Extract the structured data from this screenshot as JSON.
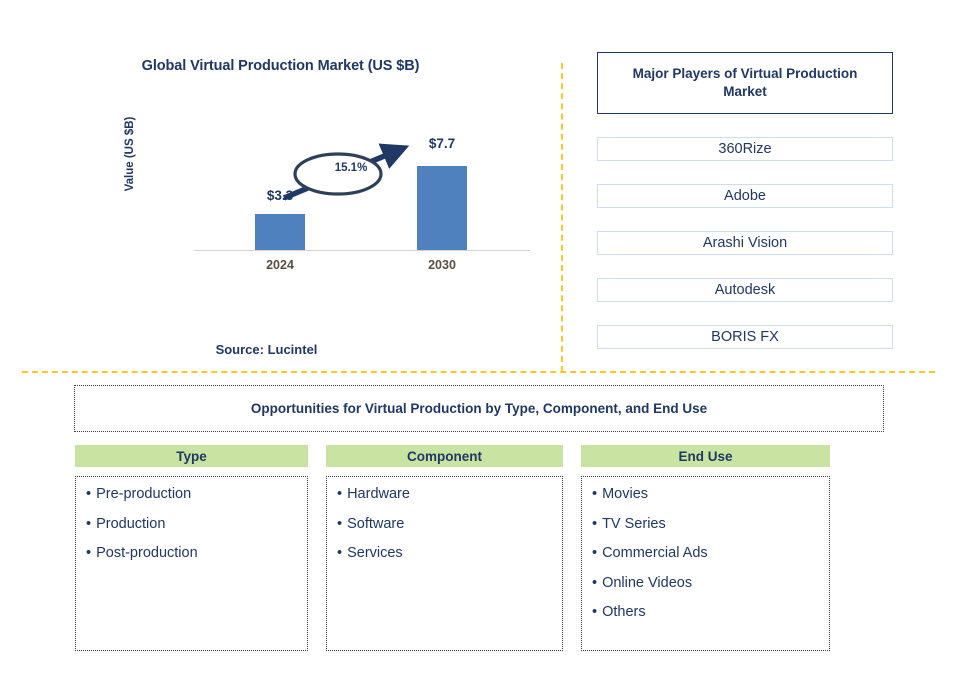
{
  "chart_panel": {
    "title": "Global Virtual Production Market (US $B)",
    "y_axis_label": "Value (US $B)",
    "cagr_label": "15.1%",
    "source": "Source: Lucintel"
  },
  "chart_data": {
    "type": "bar",
    "title": "Global Virtual Production Market (US $B)",
    "categories": [
      "2024",
      "2030"
    ],
    "values": [
      3.3,
      7.7
    ],
    "value_labels": [
      "$3.3",
      "$7.7"
    ],
    "xlabel": "",
    "ylabel": "Value (US $B)",
    "ylim": [
      0,
      9
    ],
    "grid": false,
    "legend": "none",
    "annotations": [
      {
        "text": "15.1%",
        "type": "cagr-arrow",
        "from": "2024",
        "to": "2030"
      }
    ],
    "series_color": "#4E81BD"
  },
  "players": {
    "header": "Major Players of Virtual Production Market",
    "items": [
      {
        "name": "360Rize"
      },
      {
        "name": "Adobe"
      },
      {
        "name": "Arashi Vision"
      },
      {
        "name": "Autodesk"
      },
      {
        "name": "BORIS FX"
      }
    ]
  },
  "opportunities": {
    "title": "Opportunities for Virtual Production by Type, Component, and End Use",
    "columns": [
      {
        "header": "Type",
        "items": [
          "Pre-production",
          "Production",
          "Post-production"
        ]
      },
      {
        "header": "Component",
        "items": [
          "Hardware",
          "Software",
          "Services"
        ]
      },
      {
        "header": "End Use",
        "items": [
          "Movies",
          "TV Series",
          "Commercial Ads",
          "Online Videos",
          "Others"
        ]
      }
    ]
  },
  "colors": {
    "navy": "#1F3864",
    "bar_blue": "#4E81BD",
    "header_green": "#C9E3A3",
    "divider_gold": "#FFC726",
    "row_border": "#CBDDEF"
  }
}
